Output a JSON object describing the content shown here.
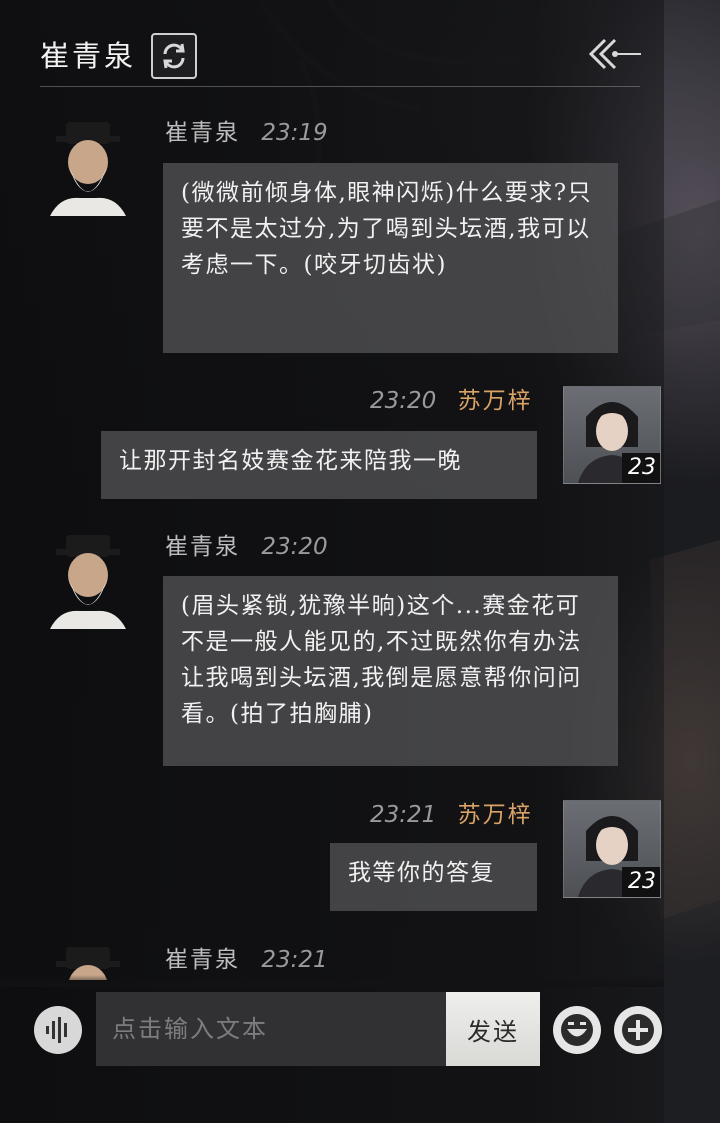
{
  "header": {
    "title": "崔青泉",
    "switch_icon": "refresh-icon",
    "back_icon": "double-chevron-left-icon"
  },
  "messages": [
    {
      "side": "left",
      "sender": "崔青泉",
      "time": "23:19",
      "text": "(微微前倾身体,眼神闪烁)什么要求?只要不是太过分,为了喝到头坛酒,我可以考虑一下。(咬牙切齿状)"
    },
    {
      "side": "right",
      "sender": "苏万梓",
      "time": "23:20",
      "level": "23",
      "text": "让那开封名妓赛金花来陪我一晚"
    },
    {
      "side": "left",
      "sender": "崔青泉",
      "time": "23:20",
      "text": "(眉头紧锁,犹豫半晌)这个...赛金花可不是一般人能见的,不过既然你有办法让我喝到头坛酒,我倒是愿意帮你问问看。(拍了拍胸脯)"
    },
    {
      "side": "right",
      "sender": "苏万梓",
      "time": "23:21",
      "level": "23",
      "text": "我等你的答复"
    },
    {
      "side": "left",
      "sender": "崔青泉",
      "time": "23:21",
      "text": ""
    }
  ],
  "input_bar": {
    "voice_icon": "voice-wave-icon",
    "placeholder": "点击输入文本",
    "send_label": "发送",
    "emoji_icon": "smile-face-icon",
    "plus_icon": "plus-icon"
  },
  "colors": {
    "self_name": "#d9a266",
    "other_name": "#bdbdbd",
    "bubble": "#58585a"
  }
}
